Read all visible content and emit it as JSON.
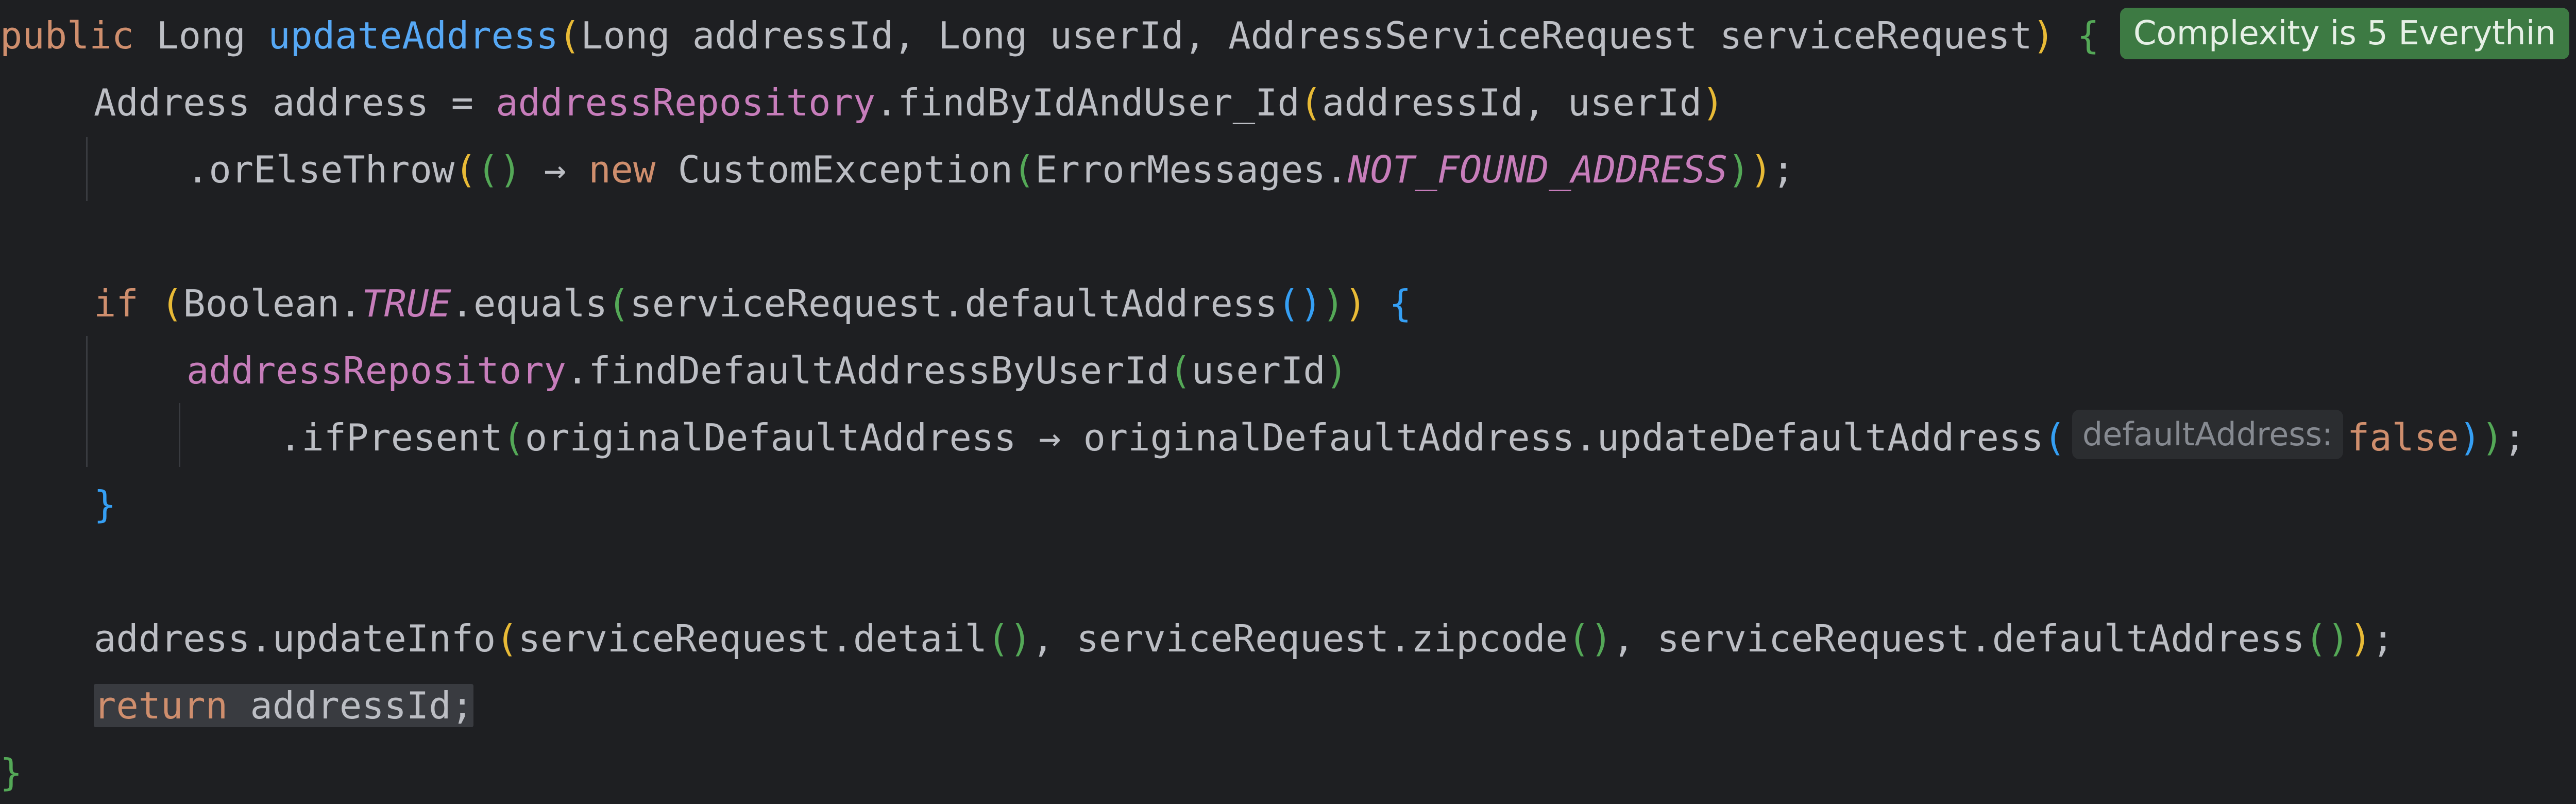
{
  "code": {
    "kw_public": "public",
    "type_long": "Long",
    "method_update_address": "updateAddress",
    "param_address_id": "addressId",
    "param_user_id": "userId",
    "type_service_request": "AddressServiceRequest",
    "param_service_request": "serviceRequest",
    "type_address": "Address",
    "var_address": "address",
    "field_repository": "addressRepository",
    "call_find_by_id_and_user": ".findByIdAndUser_Id",
    "call_or_else_throw": ".orElseThrow",
    "arrow": "→",
    "kw_new": "new",
    "type_custom_exception": "CustomException",
    "class_error_messages": "ErrorMessages.",
    "const_not_found": "NOT_FOUND_ADDRESS",
    "kw_if": "if",
    "class_boolean": "Boolean.",
    "const_true": "TRUE",
    "call_equals": ".equals",
    "call_default_address": ".defaultAddress",
    "call_find_default": ".findDefaultAddressByUserId",
    "call_if_present": ".ifPresent",
    "lambda_param": "originalDefaultAddress",
    "call_update_default": "originalDefaultAddress.updateDefaultAddress",
    "kw_false": "false",
    "call_update_info": "address.updateInfo",
    "call_detail": "serviceRequest.detail",
    "call_zipcode": "serviceRequest.zipcode",
    "call_default_address_full": "serviceRequest.defaultAddress",
    "kw_return": "return",
    "return_value": "addressId;"
  },
  "inlay_hint": {
    "param_name": "defaultAddress:"
  },
  "complexity_badge": {
    "text": "Complexity is 5 Everythin"
  }
}
